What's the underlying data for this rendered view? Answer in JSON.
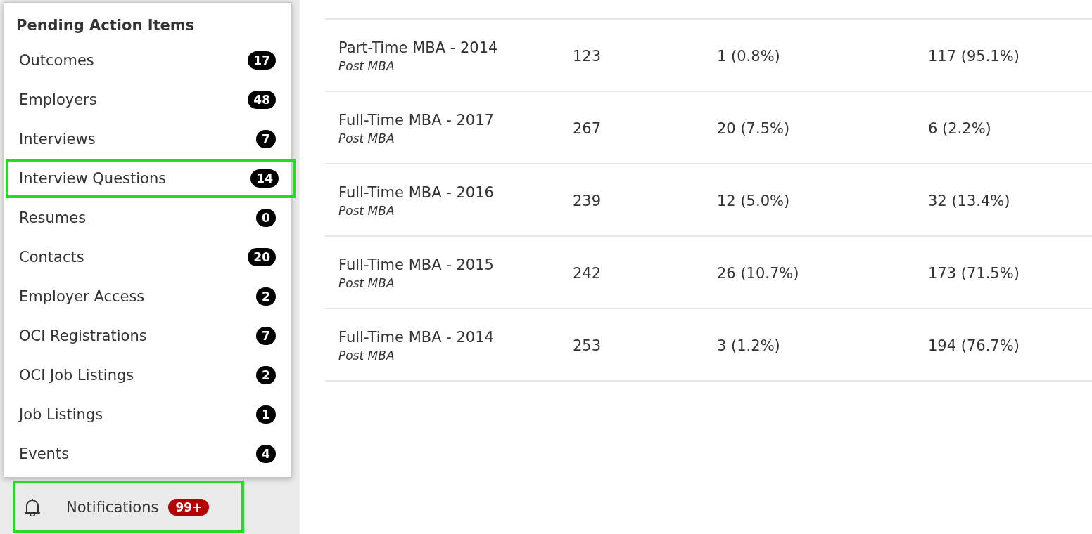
{
  "pending_menu": {
    "title": "Pending Action Items",
    "items": [
      {
        "label": "Outcomes",
        "count": "17",
        "highlighted": false
      },
      {
        "label": "Employers",
        "count": "48",
        "highlighted": false
      },
      {
        "label": "Interviews",
        "count": "7",
        "highlighted": false
      },
      {
        "label": "Interview Questions",
        "count": "14",
        "highlighted": true
      },
      {
        "label": "Resumes",
        "count": "0",
        "highlighted": false
      },
      {
        "label": "Contacts",
        "count": "20",
        "highlighted": false
      },
      {
        "label": "Employer Access",
        "count": "2",
        "highlighted": false
      },
      {
        "label": "OCI Registrations",
        "count": "7",
        "highlighted": false
      },
      {
        "label": "OCI Job Listings",
        "count": "2",
        "highlighted": false
      },
      {
        "label": "Job Listings",
        "count": "1",
        "highlighted": false
      },
      {
        "label": "Events",
        "count": "4",
        "highlighted": false
      }
    ]
  },
  "notifications": {
    "label": "Notifications",
    "count": "99+",
    "highlighted": true
  },
  "table": {
    "rows": [
      {
        "program": "Part-Time MBA - 2014",
        "type": "Post MBA",
        "column_2": "123",
        "column_3": "1 (0.8%)",
        "column_4": "117 (95.1%)"
      },
      {
        "program": "Full-Time MBA - 2017",
        "type": "Post MBA",
        "column_2": "267",
        "column_3": "20 (7.5%)",
        "column_4": "6 (2.2%)"
      },
      {
        "program": "Full-Time MBA - 2016",
        "type": "Post MBA",
        "column_2": "239",
        "column_3": "12 (5.0%)",
        "column_4": "32 (13.4%)"
      },
      {
        "program": "Full-Time MBA - 2015",
        "type": "Post MBA",
        "column_2": "242",
        "column_3": "26 (10.7%)",
        "column_4": "173 (71.5%)"
      },
      {
        "program": "Full-Time MBA - 2014",
        "type": "Post MBA",
        "column_2": "253",
        "column_3": "3 (1.2%)",
        "column_4": "194 (76.7%)"
      }
    ]
  }
}
